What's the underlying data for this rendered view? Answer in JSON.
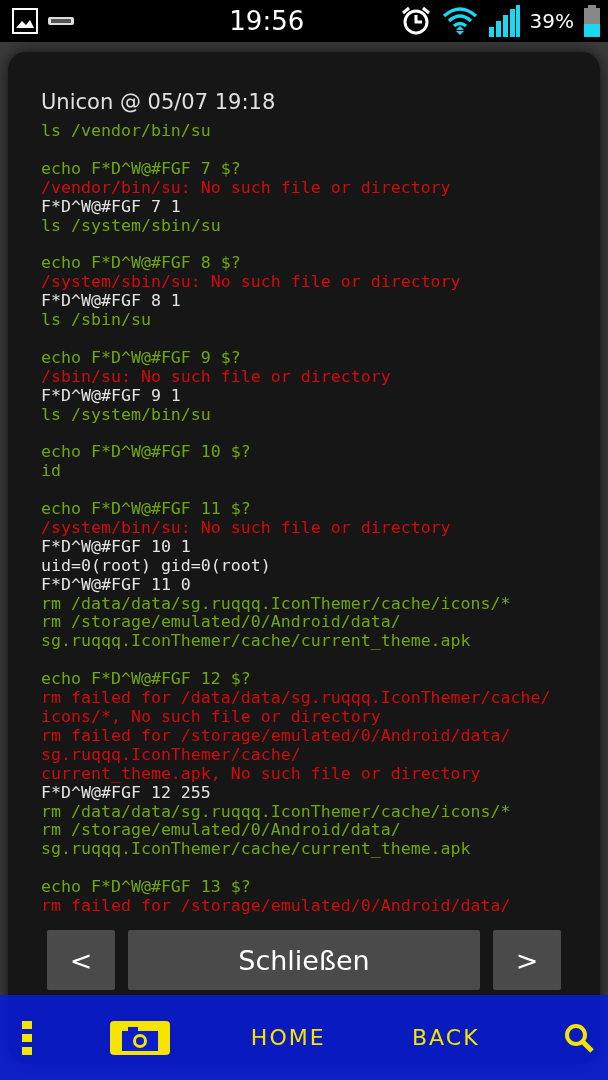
{
  "status_bar": {
    "time": "19:56",
    "battery": "39%"
  },
  "dialog": {
    "title": "Unicon @ 05/07 19:18",
    "log": [
      {
        "lines": [
          {
            "kind": "cmd",
            "text": "ls /vendor/bin/su"
          }
        ]
      },
      {
        "lines": [
          {
            "kind": "cmd",
            "text": "echo F*D^W@#FGF 7 $?"
          },
          {
            "kind": "err",
            "text": "/vendor/bin/su: No such file or directory"
          },
          {
            "kind": "out",
            "text": "F*D^W@#FGF 7 1"
          },
          {
            "kind": "cmd",
            "text": "ls /system/sbin/su"
          }
        ]
      },
      {
        "lines": [
          {
            "kind": "cmd",
            "text": "echo F*D^W@#FGF 8 $?"
          },
          {
            "kind": "err",
            "text": "/system/sbin/su: No such file or directory"
          },
          {
            "kind": "out",
            "text": "F*D^W@#FGF 8 1"
          },
          {
            "kind": "cmd",
            "text": "ls /sbin/su"
          }
        ]
      },
      {
        "lines": [
          {
            "kind": "cmd",
            "text": "echo F*D^W@#FGF 9 $?"
          },
          {
            "kind": "err",
            "text": "/sbin/su: No such file or directory"
          },
          {
            "kind": "out",
            "text": "F*D^W@#FGF 9 1"
          },
          {
            "kind": "cmd",
            "text": "ls /system/bin/su"
          }
        ]
      },
      {
        "lines": [
          {
            "kind": "cmd",
            "text": "echo F*D^W@#FGF 10 $?"
          },
          {
            "kind": "cmd",
            "text": "id"
          }
        ]
      },
      {
        "lines": [
          {
            "kind": "cmd",
            "text": "echo F*D^W@#FGF 11 $?"
          },
          {
            "kind": "err",
            "text": "/system/bin/su: No such file or directory"
          },
          {
            "kind": "out",
            "text": "F*D^W@#FGF 10 1"
          },
          {
            "kind": "out",
            "text": "uid=0(root) gid=0(root)"
          },
          {
            "kind": "out",
            "text": "F*D^W@#FGF 11 0"
          },
          {
            "kind": "cmd",
            "text": "rm /data/data/sg.ruqqq.IconThemer/cache/icons/*"
          },
          {
            "kind": "cmd",
            "text": "rm /storage/emulated/0/Android/data/"
          },
          {
            "kind": "cmd",
            "text": "sg.ruqqq.IconThemer/cache/current_theme.apk"
          }
        ]
      },
      {
        "lines": [
          {
            "kind": "cmd",
            "text": "echo F*D^W@#FGF 12 $?"
          },
          {
            "kind": "err",
            "text": "rm failed for /data/data/sg.ruqqq.IconThemer/cache/"
          },
          {
            "kind": "err",
            "text": "icons/*, No such file or directory"
          },
          {
            "kind": "err",
            "text": "rm failed for /storage/emulated/0/Android/data/"
          },
          {
            "kind": "err",
            "text": "sg.ruqqq.IconThemer/cache/"
          },
          {
            "kind": "err",
            "text": "current_theme.apk, No such file or directory"
          },
          {
            "kind": "out",
            "text": "F*D^W@#FGF 12 255"
          },
          {
            "kind": "cmd",
            "text": "rm /data/data/sg.ruqqq.IconThemer/cache/icons/*"
          },
          {
            "kind": "cmd",
            "text": "rm /storage/emulated/0/Android/data/"
          },
          {
            "kind": "cmd",
            "text": "sg.ruqqq.IconThemer/cache/current_theme.apk"
          }
        ]
      },
      {
        "lines": [
          {
            "kind": "cmd",
            "text": "echo F*D^W@#FGF 13 $?"
          },
          {
            "kind": "err",
            "text": "rm failed for /storage/emulated/0/Android/data/"
          }
        ]
      }
    ],
    "buttons": {
      "prev": "<",
      "close": "Schließen",
      "next": ">"
    }
  },
  "nav": {
    "home": "HOME",
    "back": "BACK"
  }
}
